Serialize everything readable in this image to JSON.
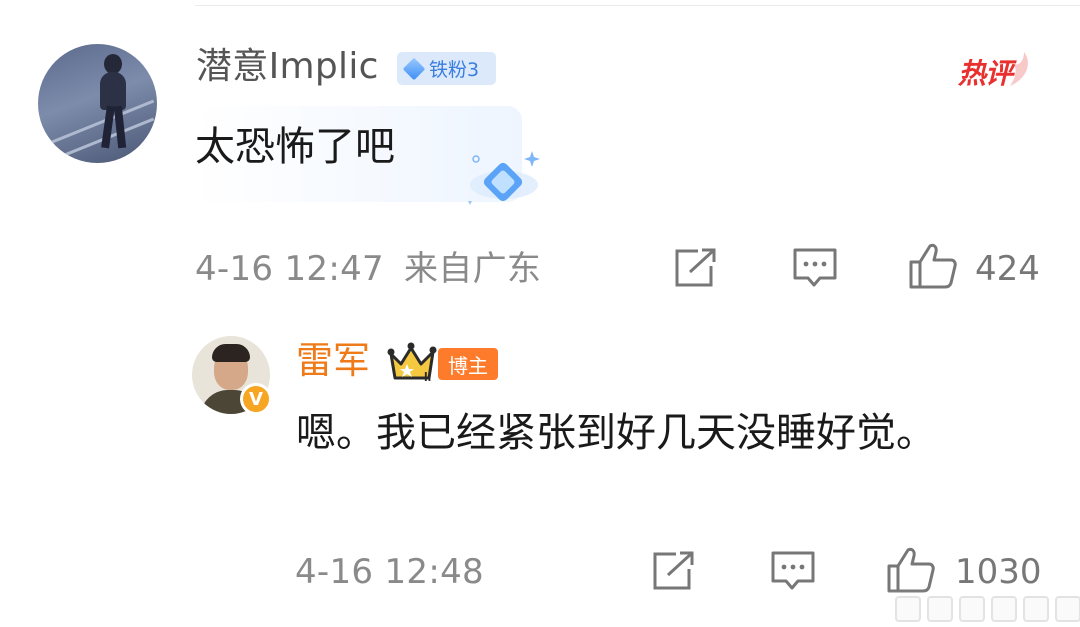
{
  "comments": [
    {
      "username": "潜意Implic",
      "fan_badge": "铁粉3",
      "hot_tag": "热评",
      "text": "太恐怖了吧",
      "time": "4-16 12:47",
      "location": "来自广东",
      "like_count": "424"
    },
    {
      "username": "雷军",
      "role_badge": "博主",
      "crown_level": "II",
      "verified_mark": "V",
      "text": "嗯。我已经紧张到好几天没睡好觉。",
      "time": "4-16 12:48",
      "like_count": "1030"
    }
  ],
  "icons": {
    "share": "share-icon",
    "comment": "comment-icon",
    "like": "thumbs-up-icon"
  },
  "colors": {
    "username_blogger": "#ee7a19",
    "hot_red": "#e8312f",
    "fan_badge_bg": "#dbe9fb",
    "meta_gray": "#8a8a8a"
  }
}
